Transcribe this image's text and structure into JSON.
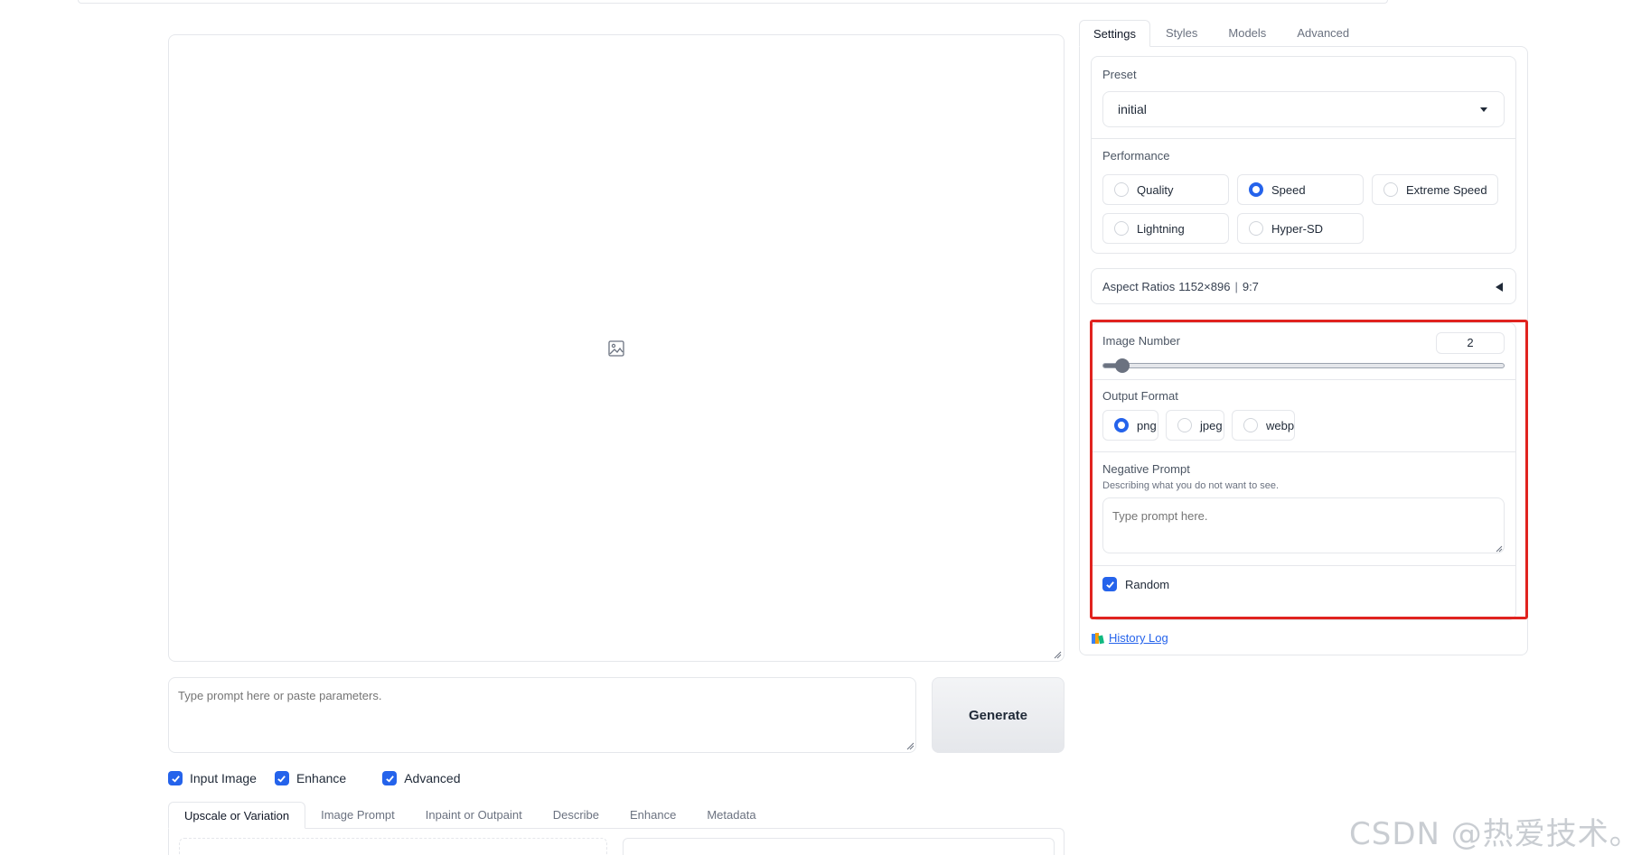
{
  "canvas": {},
  "main": {
    "prompt_placeholder": "Type prompt here or paste parameters.",
    "generate_label": "Generate",
    "checkboxes": [
      {
        "label": "Input Image",
        "checked": true
      },
      {
        "label": "Enhance",
        "checked": true
      },
      {
        "label": "Advanced",
        "checked": true
      }
    ],
    "bottom_tabs": [
      "Upscale or Variation",
      "Image Prompt",
      "Inpaint or Outpaint",
      "Describe",
      "Enhance",
      "Metadata"
    ],
    "active_bottom_tab": "Upscale or Variation"
  },
  "right": {
    "tabs": [
      "Settings",
      "Styles",
      "Models",
      "Advanced"
    ],
    "active_tab": "Settings",
    "preset": {
      "label": "Preset",
      "value": "initial"
    },
    "performance": {
      "label": "Performance",
      "options": [
        "Quality",
        "Speed",
        "Extreme Speed",
        "Lightning",
        "Hyper-SD"
      ],
      "selected": "Speed"
    },
    "aspect_ratios": {
      "label": "Aspect Ratios",
      "value": "1152×896",
      "ratio": "9:7"
    },
    "image_number": {
      "label": "Image Number",
      "value": "2",
      "fraction": 0.03
    },
    "output_format": {
      "label": "Output Format",
      "options": [
        "png",
        "jpeg",
        "webp"
      ],
      "selected": "png"
    },
    "negative_prompt": {
      "label": "Negative Prompt",
      "description": "Describing what you do not want to see.",
      "placeholder": "Type prompt here."
    },
    "random": {
      "label": "Random",
      "checked": true
    },
    "history_log": "History Log"
  },
  "colors": {
    "accent": "#2563eb",
    "highlight": "#e0231f",
    "border": "#e5e7eb"
  },
  "watermark": "CSDN @热爱技术。"
}
